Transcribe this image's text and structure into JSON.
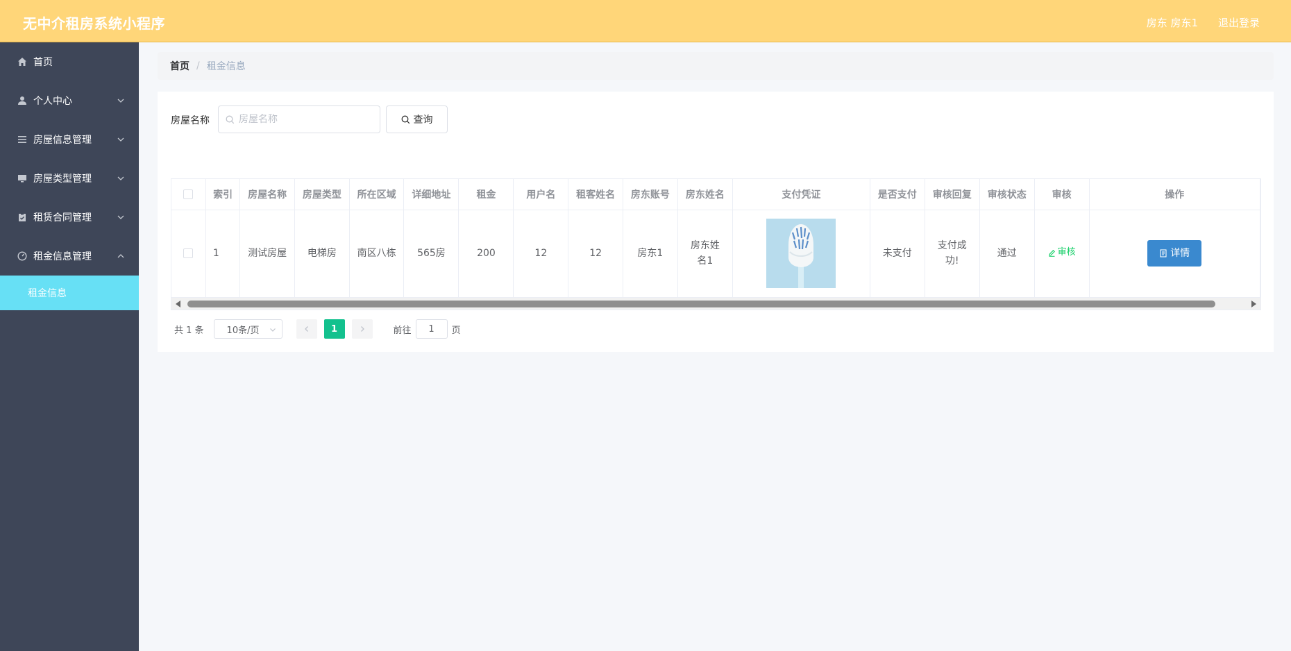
{
  "header": {
    "title": "无中介租房系统小程序",
    "user": "房东 房东1",
    "logout": "退出登录"
  },
  "sidebar": {
    "items": [
      {
        "label": "首页",
        "icon": "home-icon"
      },
      {
        "label": "个人中心",
        "icon": "user-icon"
      },
      {
        "label": "房屋信息管理",
        "icon": "list-icon"
      },
      {
        "label": "房屋类型管理",
        "icon": "monitor-icon"
      },
      {
        "label": "租赁合同管理",
        "icon": "clipboard-icon"
      },
      {
        "label": "租金信息管理",
        "icon": "gauge-icon"
      }
    ],
    "active_sub": "租金信息"
  },
  "breadcrumb": {
    "home": "首页",
    "sep": "/",
    "current": "租金信息"
  },
  "search": {
    "label": "房屋名称",
    "placeholder": "房屋名称",
    "value": "",
    "button": "查询"
  },
  "table": {
    "columns": [
      "索引",
      "房屋名称",
      "房屋类型",
      "所在区域",
      "详细地址",
      "租金",
      "用户名",
      "租客姓名",
      "房东账号",
      "房东姓名",
      "支付凭证",
      "是否支付",
      "审核回复",
      "审核状态",
      "审核",
      "操作"
    ],
    "rows": [
      {
        "index": "1",
        "house_name": "测试房屋",
        "house_type": "电梯房",
        "area": "南区八栋",
        "address": "565房",
        "rent": "200",
        "username": "12",
        "tenant_name": "12",
        "landlord_account": "房东1",
        "landlord_name": "房东姓名1",
        "paid": "未支付",
        "review_reply": "支付成功!",
        "review_status": "通过",
        "audit_label": "审核",
        "detail_label": "详情"
      }
    ]
  },
  "pagination": {
    "total": "共 1 条",
    "page_size": "10条/页",
    "current": "1",
    "goto_label": "前往",
    "goto_value": "1",
    "page_unit": "页"
  },
  "colors": {
    "header": "#ffd679",
    "sidebar": "#3e4658",
    "active_sub": "#67e0f5",
    "accent_green": "#13c18e",
    "detail_blue": "#3a89cf"
  }
}
